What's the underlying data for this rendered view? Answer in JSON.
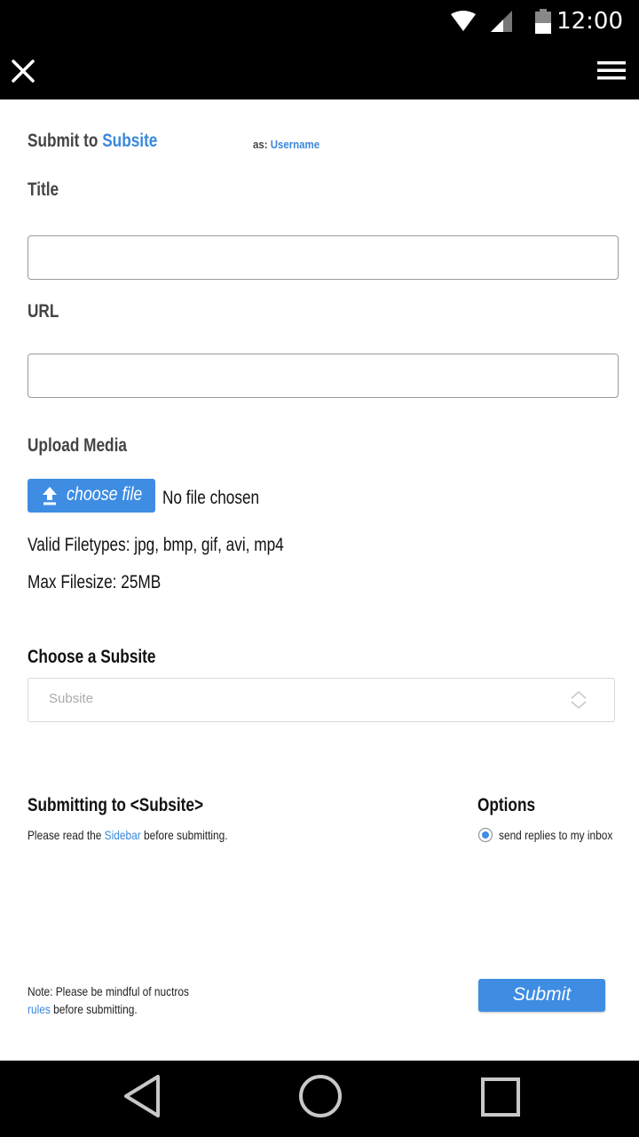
{
  "status_bar": {
    "time": "12:00"
  },
  "form": {
    "title_prefix": "Submit to",
    "title_subsite": "Subsite",
    "as_label": "as:",
    "username": "Username",
    "title_label": "Title",
    "title_value": "",
    "url_label": "URL",
    "url_value": "",
    "upload_label": "Upload Media",
    "choose_file_label": "choose file",
    "no_file_text": "No file chosen",
    "valid_filetypes": "Valid Filetypes: jpg, bmp, gif, avi, mp4",
    "max_filesize": "Max Filesize: 25MB",
    "choose_subsite_label": "Choose a Subsite",
    "subsite_select_value": "Subsite"
  },
  "submitting": {
    "heading": "Submitting to <Subsite>",
    "read_prefix": "Please read the",
    "sidebar_link": "Sidebar",
    "read_suffix": "before submitting."
  },
  "options": {
    "heading": "Options",
    "send_replies_label": "send replies to my inbox",
    "send_replies_checked": true
  },
  "footer": {
    "note_prefix": "Note: Please be mindful of nuctros",
    "rules_link": "rules",
    "note_suffix": "before submitting.",
    "submit_label": "Submit"
  },
  "colors": {
    "accent": "#3e8de3",
    "link": "#3a88dc",
    "bar": "#000000"
  },
  "icons": [
    "wifi-icon",
    "signal-icon",
    "battery-icon",
    "close-icon",
    "menu-icon",
    "upload-icon",
    "select-arrows-icon",
    "back-icon",
    "home-icon",
    "recents-icon"
  ]
}
